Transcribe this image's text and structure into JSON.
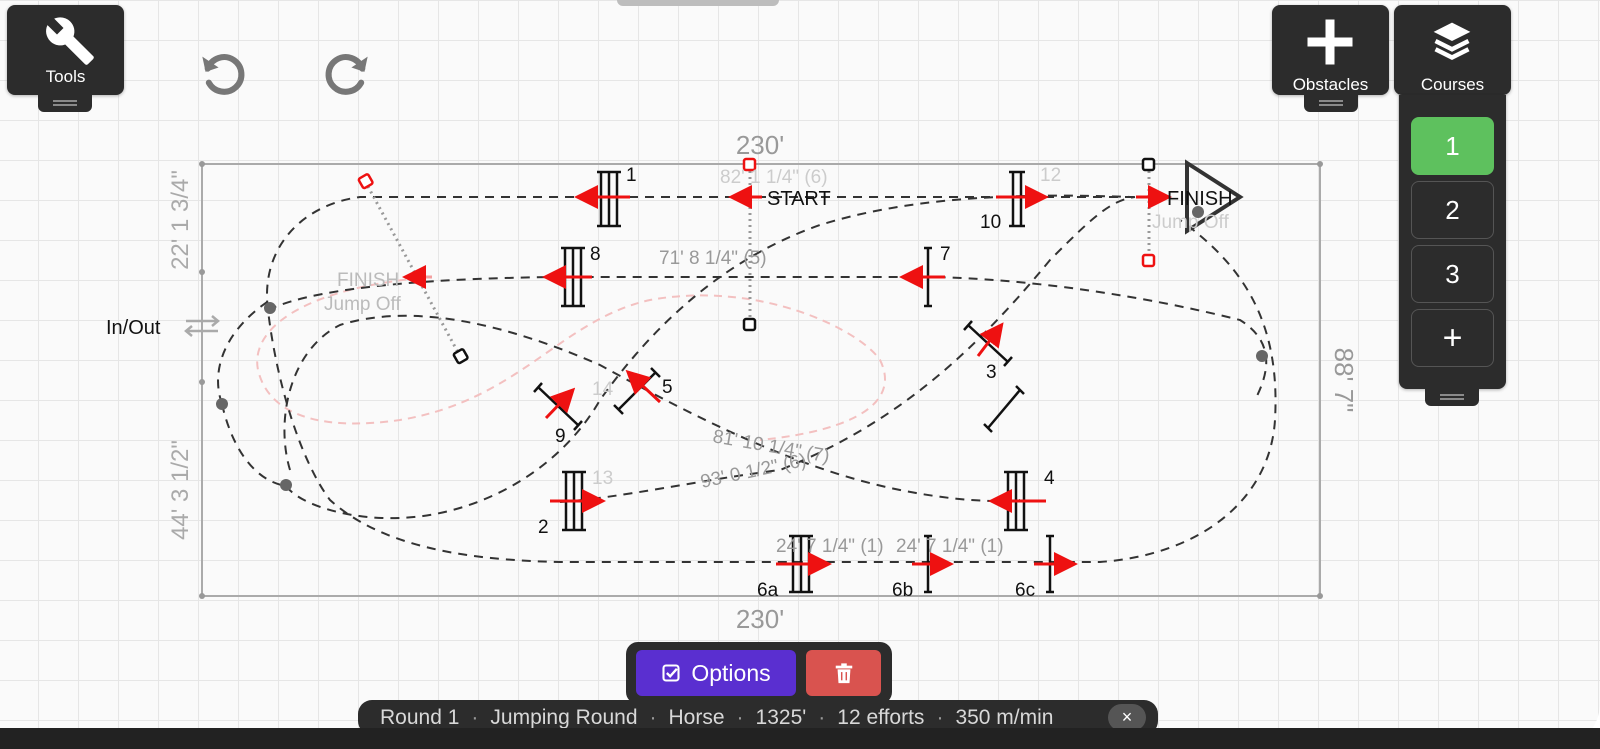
{
  "toolbar": {
    "tools_label": "Tools",
    "obstacles_label": "Obstacles",
    "courses_label": "Courses"
  },
  "courses": {
    "items": [
      "1",
      "2",
      "3"
    ],
    "add_label": "+",
    "active_index": 0
  },
  "arena": {
    "width_label_top": "230'",
    "width_label_bottom": "230'",
    "height_label_right": "88' 7\"",
    "left_upper_label": "22' 1 3/4\"",
    "left_lower_label": "44' 3 1/2\"",
    "in_out_label": "In/Out"
  },
  "course": {
    "start_label": "START",
    "finish_label": "FINISH",
    "jumpoff_finish_label": "FINISH",
    "jumpoff_label": "Jump Off",
    "jumpoff_label_2": "Jump Off",
    "distance_labels": {
      "d1": "82' 1 1/4\" (6)",
      "d2": "71' 8 1/4\" (5)",
      "d3": "81' 10 1/4\" (7)",
      "d4": "93' 0 1/2\" (6)",
      "d5": "24' 7 1/4\" (1)",
      "d6": "24' 7 1/4\" (1)"
    },
    "obstacle_numbers": {
      "o1": "1",
      "o2": "2",
      "o3": "3",
      "o4": "4",
      "o5": "5",
      "o6a": "6a",
      "o6b": "6b",
      "o6c": "6c",
      "o7": "7",
      "o8": "8",
      "o9": "9",
      "o10": "10",
      "o12": "12",
      "o13": "13",
      "o14": "14"
    }
  },
  "actions": {
    "options_label": "Options"
  },
  "status": {
    "round": "Round 1",
    "type": "Jumping Round",
    "animal": "Horse",
    "distance": "1325'",
    "efforts": "12 efforts",
    "speed": "350 m/min",
    "close_label": "×"
  },
  "colors": {
    "accent_purple": "#5a2fd0",
    "active_green": "#5ec15e",
    "delete_red": "#d9534f",
    "arrow_red": "#e11"
  },
  "icons": [
    "wrench-icon",
    "undo-icon",
    "redo-icon",
    "plus-icon",
    "layers-icon",
    "checkbox-icon",
    "trash-icon"
  ]
}
